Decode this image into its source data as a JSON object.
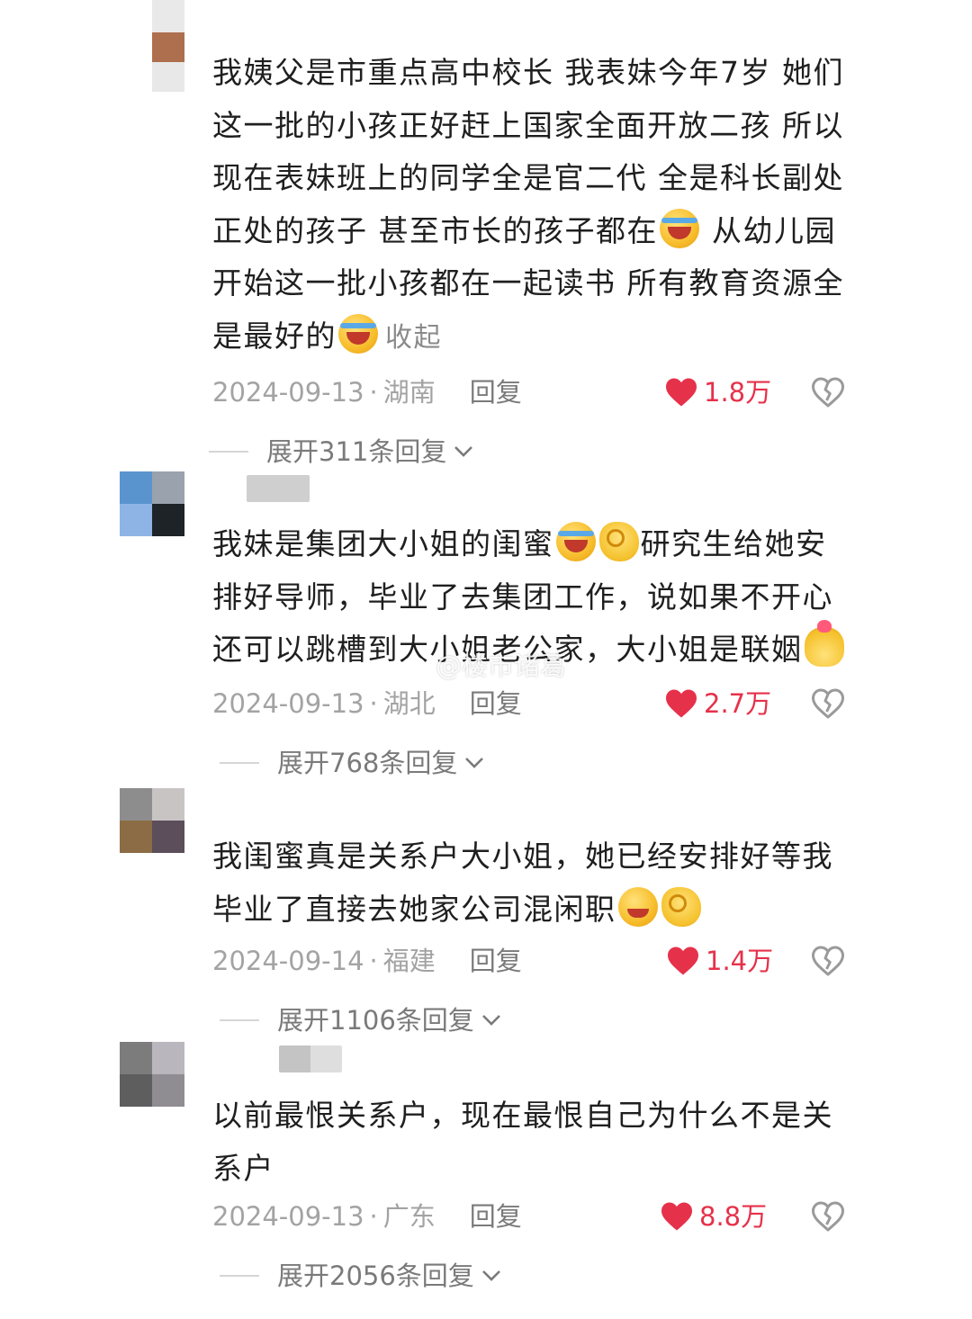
{
  "comments": [
    {
      "text_parts": [
        "我姨父是市重点高中校长  我表妹今年7岁  她们这一批的小孩正好赶上国家全面开放二孩  所以现在表妹班上的同学全是官二代   全是科长副处正处的孩子  甚至市长的孩子都在",
        "   从幼儿园开始这一批小孩都在一起读书  所有教育资源全是最好的"
      ],
      "emojis": [
        "laugh-cry-emoji",
        "laugh-cry-emoji"
      ],
      "collapse_label": "收起",
      "date": "2024-09-13",
      "location": "湖南",
      "reply_label": "回复",
      "likes": "1.8万",
      "expand_label": "展开311条回复"
    },
    {
      "text_parts": [
        "我妹是集团大小姐的闺蜜",
        "研究生给她安排好导师，毕业了去集团工作，说如果不开心还可以跳槽到大小姐老公家，大小姐是联姻"
      ],
      "emojis": [
        "laugh-cry-emoji",
        "ok-hand-emoji",
        "heart-hand-emoji"
      ],
      "date": "2024-09-13",
      "location": "湖北",
      "reply_label": "回复",
      "likes": "2.7万",
      "expand_label": "展开768条回复"
    },
    {
      "text_parts": [
        "我闺蜜真是关系户大小姐，她已经安排好等我毕业了直接去她家公司混闲职"
      ],
      "emojis": [
        "wink-emoji",
        "ok-hand-emoji"
      ],
      "date": "2024-09-14",
      "location": "福建",
      "reply_label": "回复",
      "likes": "1.4万",
      "expand_label": "展开1106条回复"
    },
    {
      "text_parts": [
        "以前最恨关系户，现在最恨自己为什么不是关系户"
      ],
      "emojis": [],
      "date": "2024-09-13",
      "location": "广东",
      "reply_label": "回复",
      "likes": "8.8万",
      "expand_label": "展开2056条回复"
    }
  ],
  "watermark": "@楼市诸葛",
  "colors": {
    "like_red": "#e6314a",
    "meta_gray": "#a3a3a3",
    "text": "#1f1f1f"
  }
}
